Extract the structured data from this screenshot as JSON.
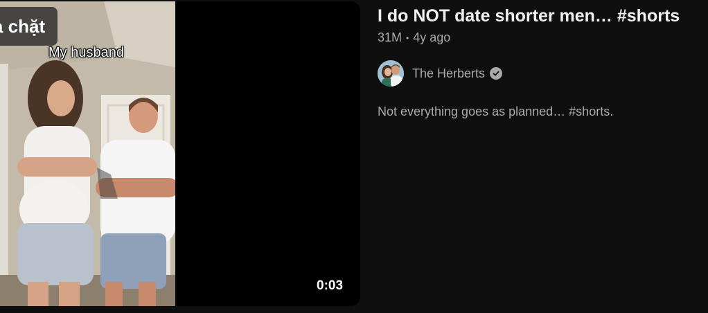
{
  "video": {
    "overlay_text": "à chặt",
    "caption": "My husband",
    "duration": "0:03",
    "title": "I do NOT date shorter men… #shorts",
    "views": "31M",
    "separator": "•",
    "age": "4y ago",
    "channel": {
      "name": "The Herberts",
      "verified": true,
      "avatar_icon": "channel-avatar-photo"
    },
    "description": "Not everything goes as planned… #shorts."
  },
  "colors": {
    "background": "#0f0f0f",
    "title": "#f1f1f1",
    "secondary_text": "#aaaaaa"
  }
}
